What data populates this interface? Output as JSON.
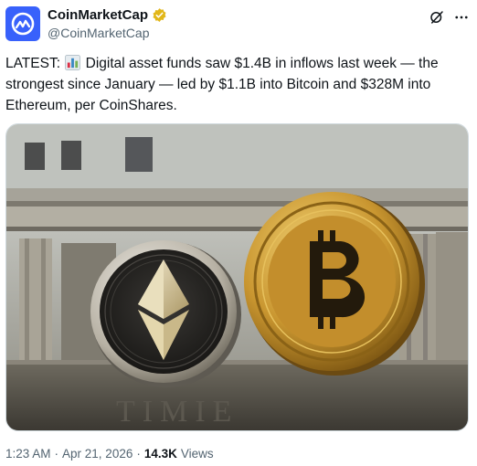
{
  "author": {
    "display_name": "CoinMarketCap",
    "handle": "@CoinMarketCap",
    "verified": true,
    "verified_color": "#e2b719",
    "avatar_color": "#3861fb"
  },
  "actions": {
    "grok_icon": "grok-icon",
    "more_icon": "more-icon"
  },
  "tweet": {
    "text_before_emoji": "LATEST: ",
    "emoji": "bar-chart-emoji",
    "text_after_emoji": " Digital asset funds saw $1.4B in inflows last week — the strongest since January — led by $1.1B into Bitcoin and $328M into Ethereum, per CoinShares."
  },
  "media": {
    "type": "photo",
    "subject": "ethereum-and-bitcoin-coins"
  },
  "meta": {
    "time": "1:23 AM",
    "separator": "·",
    "date": "Apr 21, 2026",
    "views_count": "14.3K",
    "views_label": "Views"
  }
}
